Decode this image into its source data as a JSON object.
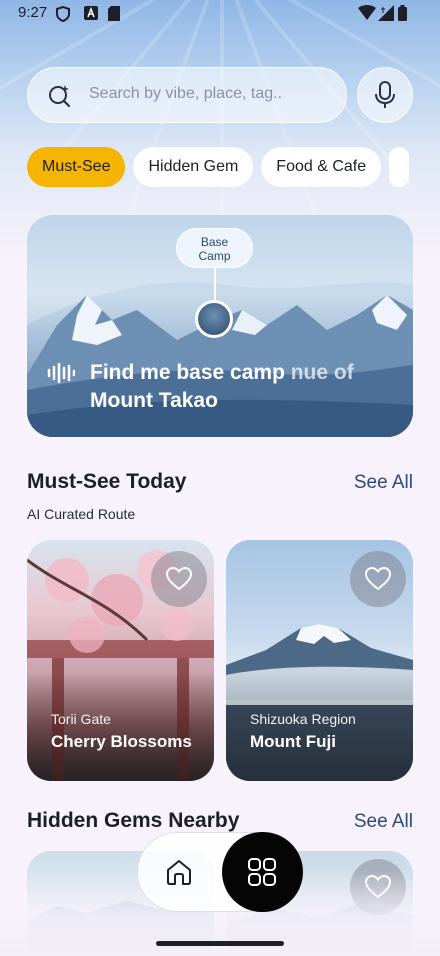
{
  "status_bar": {
    "time": "9:27"
  },
  "search": {
    "placeholder": "Search by vibe, place, tag.."
  },
  "chips": [
    {
      "label": "Must-See",
      "active": true
    },
    {
      "label": "Hidden Gem",
      "active": false
    },
    {
      "label": "Food & Cafe",
      "active": false
    }
  ],
  "hero": {
    "pin_label_line1": "Base",
    "pin_label_line2": "Camp",
    "title_main": "Find me base camp ",
    "title_muted": "nue of",
    "title_line2": "Mount Takao"
  },
  "must_see": {
    "title": "Must-See Today",
    "see_all": "See All",
    "subtitle": "AI Curated Route",
    "cards": [
      {
        "subtitle": "Torii Gate",
        "title": "Cherry Blossoms"
      },
      {
        "subtitle": "Shizuoka Region",
        "title": "Mount Fuji"
      }
    ]
  },
  "hidden_gems": {
    "title": "Hidden Gems Nearby",
    "see_all": "See All"
  },
  "colors": {
    "accent": "#f5b400",
    "link": "#2c4a7a",
    "nav_active": "#050505"
  },
  "icons": {
    "search": "sparkle-search-icon",
    "mic": "microphone-icon",
    "heart": "heart-icon",
    "home": "home-icon",
    "grid": "grid-icon",
    "voice": "sound-wave-icon"
  }
}
